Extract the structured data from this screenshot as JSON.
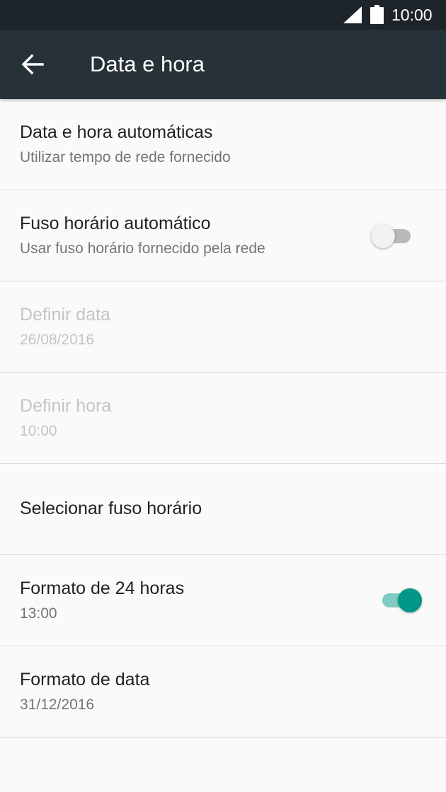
{
  "status_bar": {
    "time": "10:00",
    "icons": [
      "signal-icon",
      "battery-icon"
    ]
  },
  "app_bar": {
    "title": "Data e hora",
    "back_icon": "arrow-left-icon"
  },
  "colors": {
    "app_bar": "#263238",
    "status_bar": "#1d252a",
    "accent": "#009688"
  },
  "settings": [
    {
      "title": "Data e hora automáticas",
      "summary": "Utilizar tempo de rede fornecido"
    },
    {
      "title": "Fuso horário automático",
      "summary": "Usar fuso horário fornecido pela rede",
      "toggle": "off"
    },
    {
      "title": "Definir data",
      "summary": "26/08/2016",
      "state": "disabled"
    },
    {
      "title": "Definir hora",
      "summary": "10:00",
      "state": "disabled"
    },
    {
      "title": "Selecionar fuso horário",
      "summary": ""
    },
    {
      "title": "Formato de 24 horas",
      "summary": "13:00",
      "toggle": "on"
    },
    {
      "title": "Formato de data",
      "summary": "31/12/2016"
    }
  ]
}
